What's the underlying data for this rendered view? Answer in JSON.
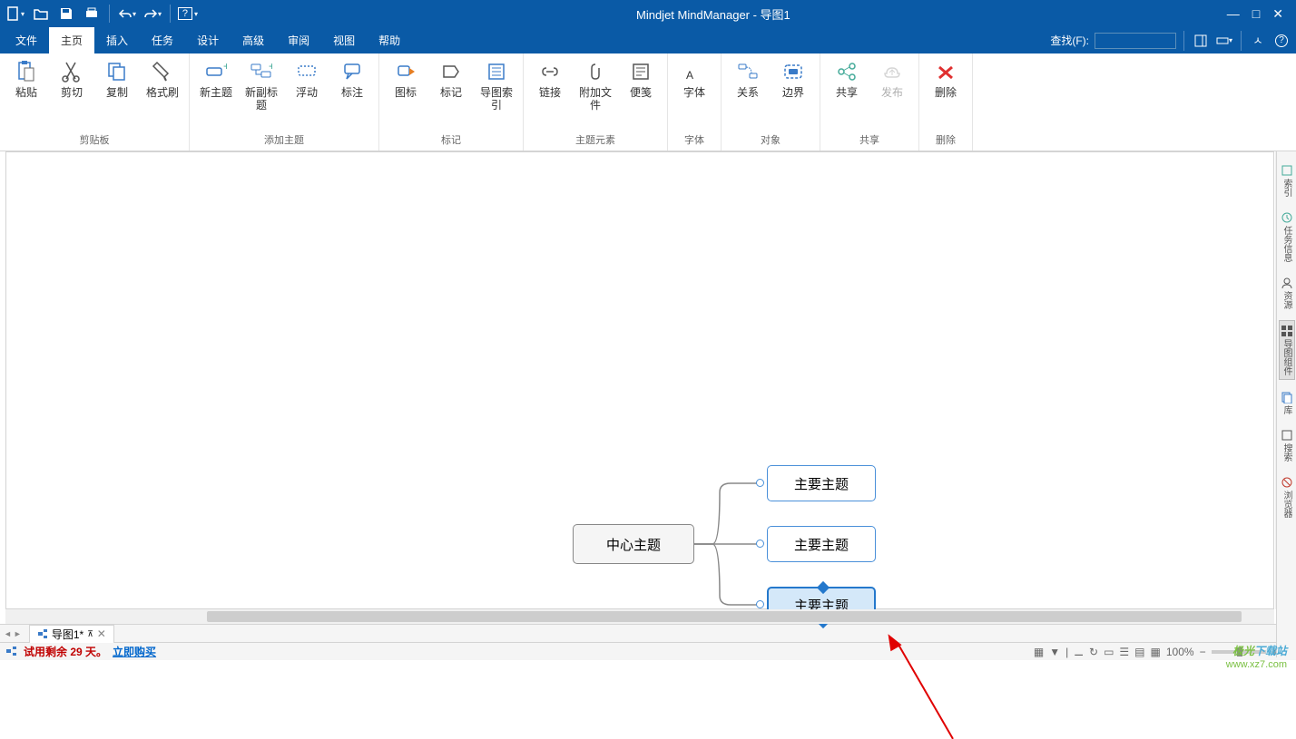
{
  "app_title": "Mindjet MindManager - 导图1",
  "window_controls": {
    "min": "—",
    "max": "□",
    "close": "✕"
  },
  "menu": {
    "items": [
      "文件",
      "主页",
      "插入",
      "任务",
      "设计",
      "高级",
      "审阅",
      "视图",
      "帮助"
    ],
    "active_index": 1,
    "find_label": "查找(F):"
  },
  "ribbon": {
    "groups": [
      {
        "title": "剪贴板",
        "buttons": [
          {
            "label": "粘贴",
            "icon": "paste"
          },
          {
            "label": "剪切",
            "icon": "cut"
          },
          {
            "label": "复制",
            "icon": "copy"
          },
          {
            "label": "格式刷",
            "icon": "brush"
          }
        ],
        "dialog": true
      },
      {
        "title": "添加主题",
        "buttons": [
          {
            "label": "新主题",
            "icon": "topic"
          },
          {
            "label": "新副标题",
            "icon": "subtopic"
          },
          {
            "label": "浮动",
            "icon": "floating"
          },
          {
            "label": "标注",
            "icon": "callout"
          }
        ]
      },
      {
        "title": "标记",
        "buttons": [
          {
            "label": "图标",
            "icon": "tag"
          },
          {
            "label": "标记",
            "icon": "marker"
          },
          {
            "label": "导图索引",
            "icon": "index"
          }
        ],
        "dialog": true
      },
      {
        "title": "主题元素",
        "buttons": [
          {
            "label": "链接",
            "icon": "link"
          },
          {
            "label": "附加文件",
            "icon": "attach"
          },
          {
            "label": "便笺",
            "icon": "note"
          }
        ],
        "dialog": true
      },
      {
        "title": "字体",
        "buttons": [
          {
            "label": "字体",
            "icon": "font"
          }
        ],
        "dialog": true
      },
      {
        "title": "对象",
        "buttons": [
          {
            "label": "关系",
            "icon": "relation"
          },
          {
            "label": "边界",
            "icon": "boundary"
          }
        ]
      },
      {
        "title": "共享",
        "buttons": [
          {
            "label": "共享",
            "icon": "share"
          },
          {
            "label": "发布",
            "icon": "publish",
            "disabled": true
          }
        ]
      },
      {
        "title": "删除",
        "buttons": [
          {
            "label": "删除",
            "icon": "delete"
          }
        ]
      }
    ]
  },
  "mindmap": {
    "center": "中心主题",
    "sub1": "主要主题",
    "sub2": "主要主题",
    "sub3": "主要主题"
  },
  "right_panel": {
    "tabs": [
      {
        "label": "索引",
        "icon": "index"
      },
      {
        "label": "任务信息",
        "icon": "task"
      },
      {
        "label": "资源",
        "icon": "resource"
      },
      {
        "label": "导图组件",
        "icon": "component",
        "active": true
      },
      {
        "label": "库",
        "icon": "library"
      },
      {
        "label": "搜索",
        "icon": "search"
      },
      {
        "label": "浏览器",
        "icon": "browser"
      }
    ]
  },
  "doc_tab": {
    "label": "导图1*",
    "pin": "⊼"
  },
  "status": {
    "trial": "试用剩余 29 天。",
    "buy": "立即购买",
    "zoom": "100%"
  },
  "watermark": {
    "line1_a": "极光",
    "line1_b": "下载站",
    "line2": "www.xz7.com"
  }
}
